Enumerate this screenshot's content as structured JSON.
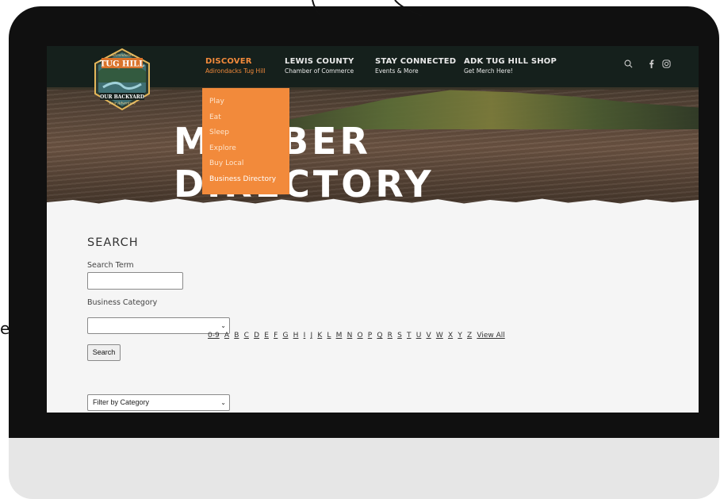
{
  "nav": {
    "items": [
      {
        "main": "DISCOVER",
        "sub": "Adirondacks Tug Hill"
      },
      {
        "main": "LEWIS COUNTY",
        "sub": "Chamber of Commerce"
      },
      {
        "main": "STAY CONNECTED",
        "sub": "Events & More"
      },
      {
        "main": "ADK TUG HILL SHOP",
        "sub": "Get Merch Here!"
      }
    ],
    "icons": [
      "search-icon",
      "facebook-icon",
      "instagram-icon"
    ]
  },
  "logo": {
    "top": "Adirondacks",
    "name": "TUG HILL",
    "banner": "OUR BACKYARD",
    "tagline": "Your Adventure"
  },
  "dropdown": {
    "items": [
      "Play",
      "Eat",
      "Sleep",
      "Explore",
      "Buy Local",
      "Business Directory"
    ]
  },
  "hero": {
    "title": "MEMBER DIRECTORY"
  },
  "search": {
    "heading": "SEARCH",
    "term_label": "Search Term",
    "term_value": "",
    "category_label": "Business Category",
    "category_value": "",
    "button": "Search",
    "filter_value": "Filter by Category"
  },
  "alphabet": [
    "0-9",
    "A",
    "B",
    "C",
    "D",
    "E",
    "F",
    "G",
    "H",
    "I",
    "J",
    "K",
    "L",
    "M",
    "N",
    "O",
    "P",
    "Q",
    "R",
    "S",
    "T",
    "U",
    "V",
    "W",
    "X",
    "Y",
    "Z",
    "View All"
  ],
  "colors": {
    "accent": "#f28a3b",
    "nav_bg": "#15201c",
    "bezel": "#101010",
    "chin": "#e6e6e6"
  }
}
